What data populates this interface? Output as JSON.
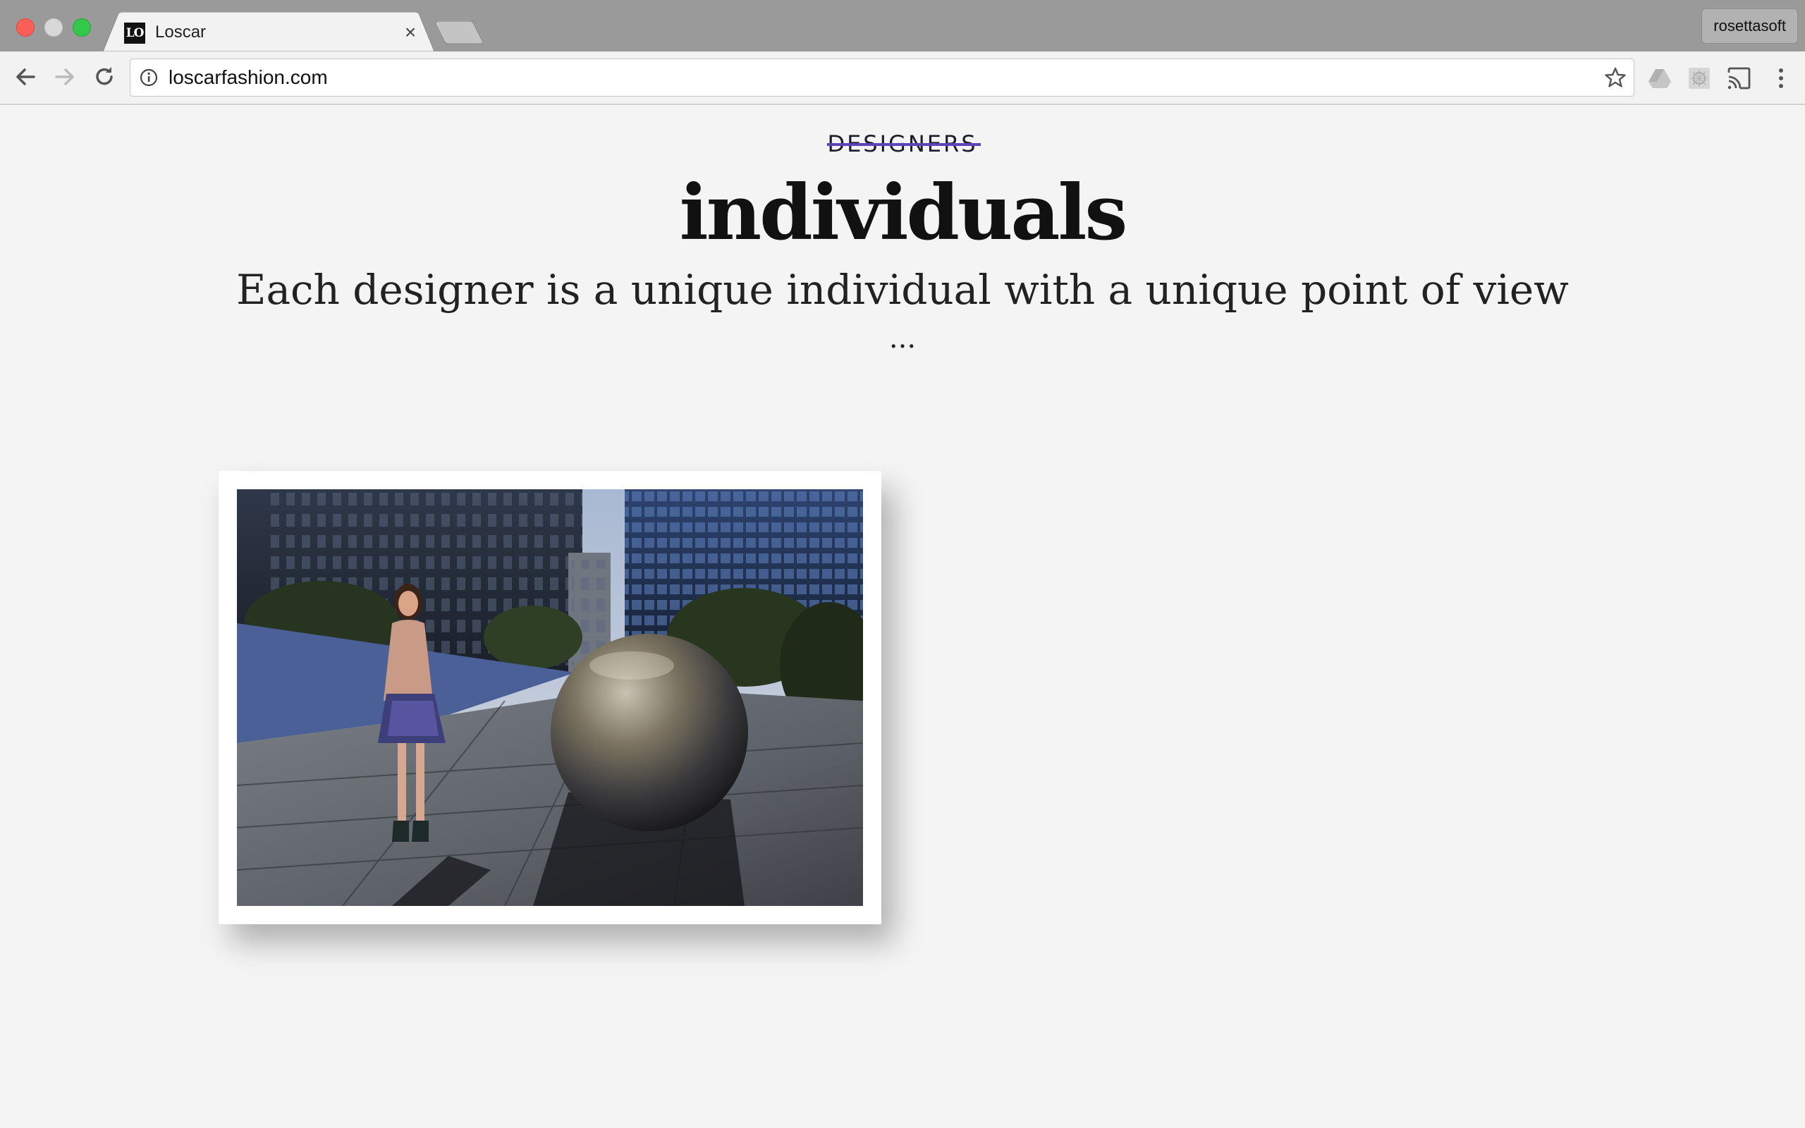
{
  "browser": {
    "tab": {
      "title": "Loscar",
      "favicon_text": "LO",
      "close_glyph": "×"
    },
    "profile_name": "rosettasoft",
    "address_bar": {
      "url": "loscarfashion.com"
    },
    "icons": {
      "back": "arrow-left-icon",
      "forward": "arrow-right-icon",
      "reload": "reload-icon",
      "info": "info-icon",
      "bookmark": "star-icon",
      "drive": "drive-icon",
      "extension": "extension-icon",
      "cast": "cast-icon",
      "menu": "kebab-menu-icon"
    }
  },
  "page": {
    "kicker": "DESIGNERS",
    "headline": "individuals",
    "subhead": "Each designer is a unique individual with a unique point of view",
    "ellipsis": "...",
    "colors": {
      "background": "#f4f4f4",
      "kicker_strike": "#5c44b8",
      "text": "#111111"
    }
  }
}
